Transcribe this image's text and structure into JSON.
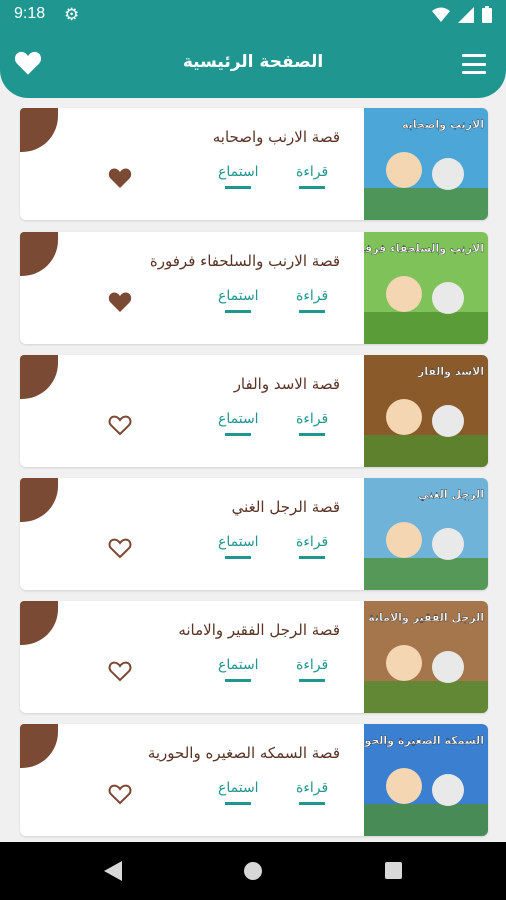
{
  "status_bar": {
    "time": "9:18"
  },
  "app_bar": {
    "title": "الصفحة الرئيسية"
  },
  "stories": [
    {
      "title": "قصة الارنب واصحابه",
      "read_label": "قراءة",
      "listen_label": "استماع",
      "favorite": true,
      "thumb_caption": "الارنب واصحابه",
      "thumb_bg": "#4da6d8"
    },
    {
      "title": "قصة الارنب والسلحفاء فرفورة",
      "read_label": "قراءة",
      "listen_label": "استماع",
      "favorite": true,
      "thumb_caption": "الارنب والسلحفاء فرفورة",
      "thumb_bg": "#7fc25a"
    },
    {
      "title": "قصة الاسد والفار",
      "read_label": "قراءة",
      "listen_label": "استماع",
      "favorite": false,
      "thumb_caption": "الاسد والفار",
      "thumb_bg": "#8a5a2a"
    },
    {
      "title": "قصة الرجل الغني",
      "read_label": "قراءة",
      "listen_label": "استماع",
      "favorite": false,
      "thumb_caption": "الرجل الغني",
      "thumb_bg": "#6fb3d8"
    },
    {
      "title": "قصة الرجل الفقير والامانه",
      "read_label": "قراءة",
      "listen_label": "استماع",
      "favorite": false,
      "thumb_caption": "الرجل الفقير والامانة",
      "thumb_bg": "#a5764c"
    },
    {
      "title": "قصة السمكه الصغيره والحورية",
      "read_label": "قراءة",
      "listen_label": "استماع",
      "favorite": false,
      "thumb_caption": "السمكة الصغيرة والحورية",
      "thumb_bg": "#3a7fd0"
    }
  ],
  "colors": {
    "primary": "#1f9790",
    "brown": "#7b4a35",
    "title_text": "#5a3324"
  }
}
